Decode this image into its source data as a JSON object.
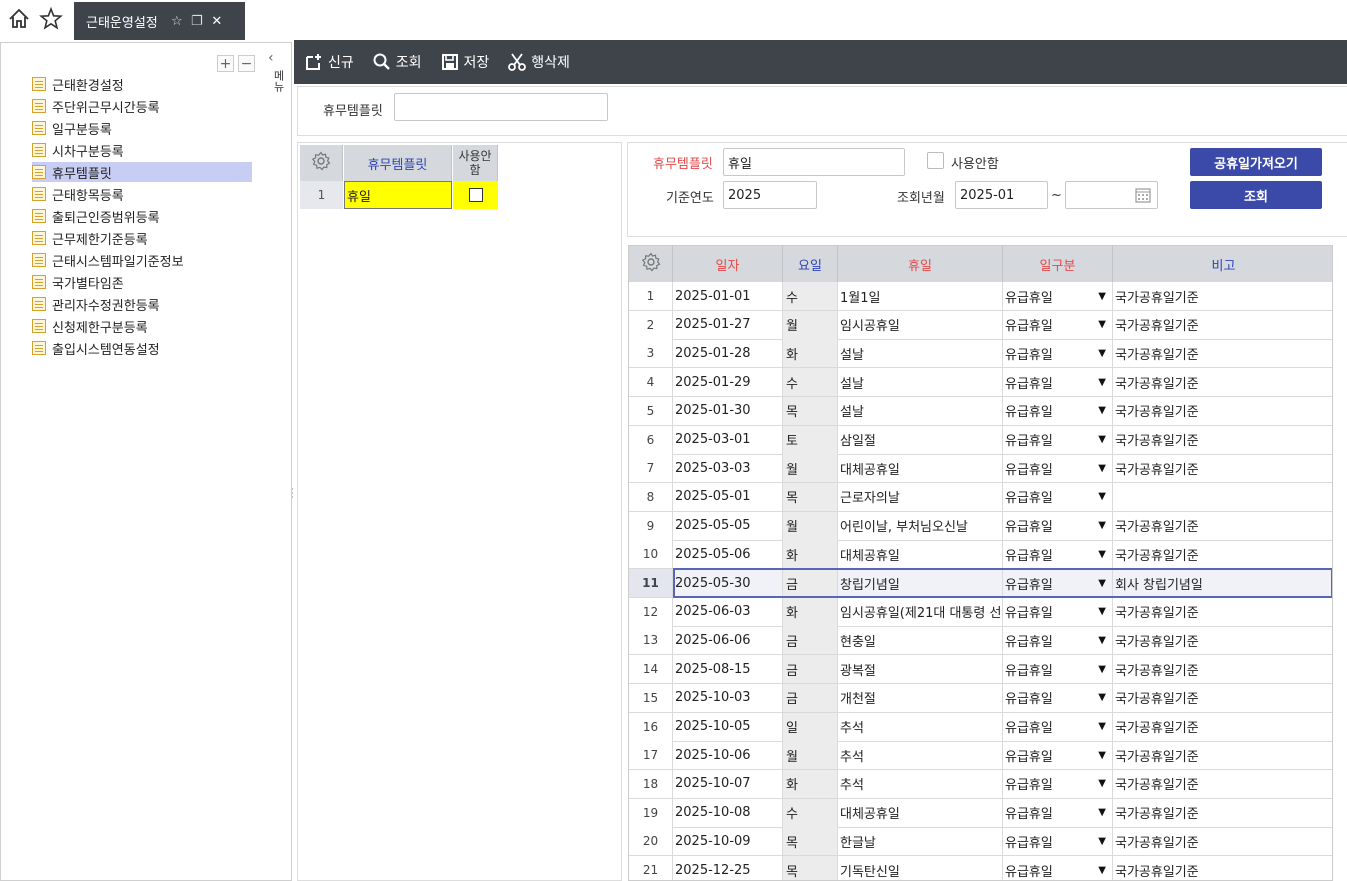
{
  "tab": {
    "title": "근태운영설정"
  },
  "tree": {
    "items": [
      "근태환경설정",
      "주단위근무시간등록",
      "일구분등록",
      "시차구분등록",
      "휴무템플릿",
      "근태항목등록",
      "출퇴근인증범위등록",
      "근무제한기준등록",
      "근태시스템파일기준정보",
      "국가별타임존",
      "관리자수정권한등록",
      "신청제한구분등록",
      "출입시스템연동설정"
    ],
    "selected": 4,
    "side_label": "메뉴"
  },
  "toolbar": {
    "new": "신규",
    "search": "조회",
    "save": "저장",
    "delete_row": "행삭제"
  },
  "search": {
    "template_label": "휴무템플릿",
    "template_value": ""
  },
  "left_grid": {
    "col_template": "휴무템플릿",
    "col_unused": "사용안함",
    "rows": [
      {
        "no": "1",
        "template": "휴일",
        "unused": false
      }
    ]
  },
  "detail": {
    "template_label": "휴무템플릿",
    "template_value": "휴일",
    "unused_label": "사용안함",
    "base_year_label": "기준연도",
    "base_year_value": "2025",
    "query_month_label": "조회년월",
    "query_from": "2025-01",
    "tilde": "~",
    "query_to": "",
    "btn_fetch": "공휴일가져오기",
    "btn_query": "조회"
  },
  "grid": {
    "headers": {
      "date": "일자",
      "dow": "요일",
      "holiday": "휴일",
      "daytype": "일구분",
      "note": "비고"
    },
    "selected_row": 10,
    "rows": [
      {
        "no": "1",
        "date": "2025-01-01",
        "dow": "수",
        "holiday": "1월1일",
        "daytype": "유급휴일",
        "note": "국가공휴일기준"
      },
      {
        "no": "2",
        "date": "2025-01-27",
        "dow": "월",
        "holiday": "임시공휴일",
        "daytype": "유급휴일",
        "note": "국가공휴일기준"
      },
      {
        "no": "3",
        "date": "2025-01-28",
        "dow": "화",
        "holiday": "설날",
        "daytype": "유급휴일",
        "note": "국가공휴일기준"
      },
      {
        "no": "4",
        "date": "2025-01-29",
        "dow": "수",
        "holiday": "설날",
        "daytype": "유급휴일",
        "note": "국가공휴일기준"
      },
      {
        "no": "5",
        "date": "2025-01-30",
        "dow": "목",
        "holiday": "설날",
        "daytype": "유급휴일",
        "note": "국가공휴일기준"
      },
      {
        "no": "6",
        "date": "2025-03-01",
        "dow": "토",
        "holiday": "삼일절",
        "daytype": "유급휴일",
        "note": "국가공휴일기준"
      },
      {
        "no": "7",
        "date": "2025-03-03",
        "dow": "월",
        "holiday": "대체공휴일",
        "daytype": "유급휴일",
        "note": "국가공휴일기준"
      },
      {
        "no": "8",
        "date": "2025-05-01",
        "dow": "목",
        "holiday": "근로자의날",
        "daytype": "유급휴일",
        "note": ""
      },
      {
        "no": "9",
        "date": "2025-05-05",
        "dow": "월",
        "holiday": "어린이날, 부처님오신날",
        "daytype": "유급휴일",
        "note": "국가공휴일기준"
      },
      {
        "no": "10",
        "date": "2025-05-06",
        "dow": "화",
        "holiday": "대체공휴일",
        "daytype": "유급휴일",
        "note": "국가공휴일기준"
      },
      {
        "no": "11",
        "date": "2025-05-30",
        "dow": "금",
        "holiday": "창립기념일",
        "daytype": "유급휴일",
        "note": "회사 창립기념일"
      },
      {
        "no": "12",
        "date": "2025-06-03",
        "dow": "화",
        "holiday": "임시공휴일(제21대 대통령 선",
        "daytype": "유급휴일",
        "note": "국가공휴일기준"
      },
      {
        "no": "13",
        "date": "2025-06-06",
        "dow": "금",
        "holiday": "현충일",
        "daytype": "유급휴일",
        "note": "국가공휴일기준"
      },
      {
        "no": "14",
        "date": "2025-08-15",
        "dow": "금",
        "holiday": "광복절",
        "daytype": "유급휴일",
        "note": "국가공휴일기준"
      },
      {
        "no": "15",
        "date": "2025-10-03",
        "dow": "금",
        "holiday": "개천절",
        "daytype": "유급휴일",
        "note": "국가공휴일기준"
      },
      {
        "no": "16",
        "date": "2025-10-05",
        "dow": "일",
        "holiday": "추석",
        "daytype": "유급휴일",
        "note": "국가공휴일기준"
      },
      {
        "no": "17",
        "date": "2025-10-06",
        "dow": "월",
        "holiday": "추석",
        "daytype": "유급휴일",
        "note": "국가공휴일기준"
      },
      {
        "no": "18",
        "date": "2025-10-07",
        "dow": "화",
        "holiday": "추석",
        "daytype": "유급휴일",
        "note": "국가공휴일기준"
      },
      {
        "no": "19",
        "date": "2025-10-08",
        "dow": "수",
        "holiday": "대체공휴일",
        "daytype": "유급휴일",
        "note": "국가공휴일기준"
      },
      {
        "no": "20",
        "date": "2025-10-09",
        "dow": "목",
        "holiday": "한글날",
        "daytype": "유급휴일",
        "note": "국가공휴일기준"
      },
      {
        "no": "21",
        "date": "2025-12-25",
        "dow": "목",
        "holiday": "기독탄신일",
        "daytype": "유급휴일",
        "note": "국가공휴일기준"
      }
    ]
  },
  "colors": {
    "toolbar_bg": "#3f444b",
    "accent_blue": "#3b49a8",
    "required_red": "#e54a4a",
    "tree_selected": "#c8cdf3",
    "cell_yellow": "#ffff00"
  }
}
